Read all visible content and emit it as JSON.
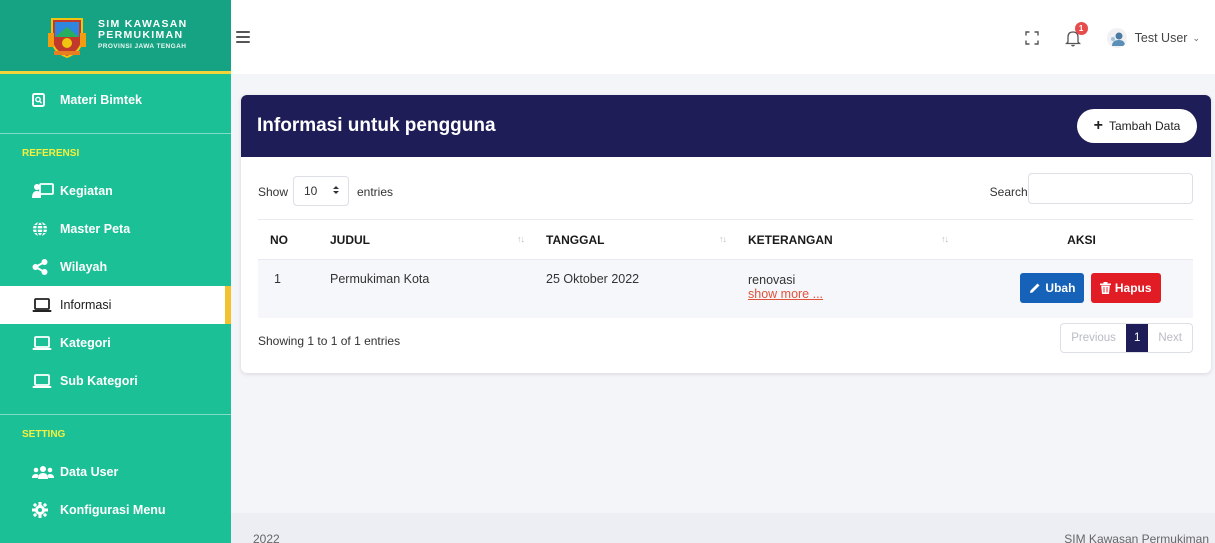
{
  "brand": {
    "line1": "SIM KAWASAN",
    "line2": "PERMUKIMAN",
    "line3": "PROVINSI JAWA TENGAH",
    "icon": "provincial-seal-logo"
  },
  "sidebar": {
    "top_item": {
      "label": "Materi Bimtek",
      "icon": "search-doc-icon"
    },
    "section_referensi": "REFERENSI",
    "referensi_items": [
      {
        "label": "Kegiatan",
        "icon": "presentation-icon"
      },
      {
        "label": "Master Peta",
        "icon": "globe-icon"
      },
      {
        "label": "Wilayah",
        "icon": "share-icon"
      },
      {
        "label": "Informasi",
        "icon": "laptop-icon",
        "active": true
      },
      {
        "label": "Kategori",
        "icon": "laptop-icon"
      },
      {
        "label": "Sub Kategori",
        "icon": "laptop-icon"
      }
    ],
    "section_setting": "SETTING",
    "setting_items": [
      {
        "label": "Data User",
        "icon": "users-icon"
      },
      {
        "label": "Konfigurasi Menu",
        "icon": "gear-icon"
      }
    ]
  },
  "topbar": {
    "notification_count": "1",
    "user_name": "Test User",
    "caret": "⌄"
  },
  "card": {
    "title": "Informasi untuk pengguna",
    "add_button": "Tambah Data",
    "show_label": "Show",
    "entries_value": "10",
    "entries_label": "entries",
    "search_label": "Search:",
    "search_value": "",
    "columns": [
      "NO",
      "JUDUL",
      "TANGGAL",
      "KETERANGAN",
      "AKSI"
    ],
    "rows": [
      {
        "no": "1",
        "judul": "Permukiman Kota",
        "tanggal": "25 Oktober 2022",
        "keterangan": "renovasi",
        "show_more": "show more ..."
      }
    ],
    "edit_button": "Ubah",
    "delete_button": "Hapus",
    "info": "Showing 1 to 1 of 1 entries",
    "pagination": {
      "previous": "Previous",
      "current": "1",
      "next": "Next"
    }
  },
  "footer": {
    "left": "2022",
    "right": "SIM Kawasan Permukiman"
  },
  "colors": {
    "sidebar": "#1bc097",
    "header": "#1f1d58",
    "accent": "#f2c12e",
    "edit": "#1662b8",
    "delete": "#e11c24"
  }
}
